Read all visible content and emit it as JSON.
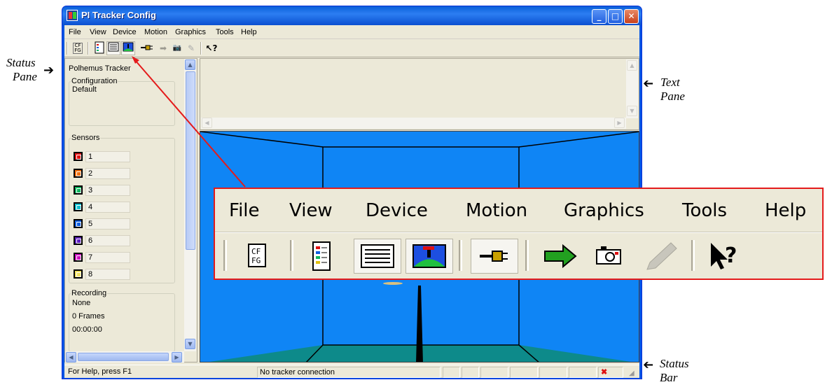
{
  "annotations": {
    "status_pane": [
      "Status",
      "Pane"
    ],
    "text_pane": [
      "Text",
      "Pane"
    ],
    "status_bar": [
      "Status",
      "Bar"
    ]
  },
  "window": {
    "title": "PI Tracker Config",
    "controls": {
      "minimize": "_",
      "maximize": "□",
      "close": "✕"
    }
  },
  "menu": [
    "File",
    "View",
    "Device",
    "Motion",
    "Graphics",
    "Tools",
    "Help"
  ],
  "toolbar_icons": [
    "config-file-icon",
    "status-pane-icon",
    "text-pane-icon",
    "graphics-icon",
    "connect-plug-icon",
    "start-motion-icon",
    "camera-icon",
    "pencil-icon",
    "context-help-icon"
  ],
  "status_pane": {
    "title": "Polhemus Tracker",
    "configuration": {
      "label": "Configuration",
      "value": "Default"
    },
    "sensors": {
      "label": "Sensors",
      "items": [
        {
          "num": "1",
          "color": "#e01010"
        },
        {
          "num": "2",
          "color": "#f07010"
        },
        {
          "num": "3",
          "color": "#10b860"
        },
        {
          "num": "4",
          "color": "#10c0d0"
        },
        {
          "num": "5",
          "color": "#1060e0"
        },
        {
          "num": "6",
          "color": "#6020c0"
        },
        {
          "num": "7",
          "color": "#d010c0"
        },
        {
          "num": "8",
          "color": "#f0e060"
        }
      ]
    },
    "recording": {
      "label": "Recording",
      "status": "None",
      "frames": "0 Frames",
      "time": "00:00:00"
    }
  },
  "statusbar": {
    "help": "For Help, press F1",
    "connection": "No tracker connection"
  },
  "colors": {
    "graphics_bg": "#0f85f5",
    "floor": "#0d8a8a",
    "callout_border": "#e41b1b"
  }
}
